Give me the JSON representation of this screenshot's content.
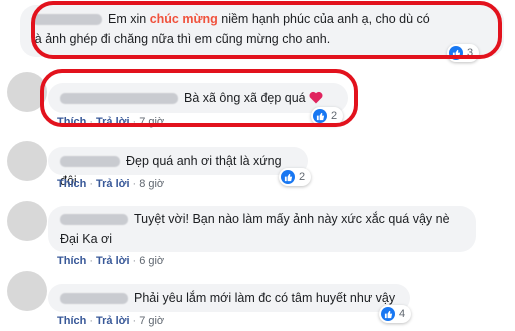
{
  "comments": [
    {
      "text_before": "Em xin ",
      "highlight": "chúc mừng",
      "text_after": " niềm hạnh phúc của anh ạ, cho dù có",
      "text_line2": "là ảnh ghép đi chăng nữa thì em cũng mừng cho anh.",
      "reactions": "3"
    },
    {
      "text": "Bà xã ông xã đẹp quá",
      "emoji": "heart-icon",
      "like": "Thích",
      "reply": "Trả lời",
      "time": "7 giờ",
      "reactions": "2"
    },
    {
      "text": "Đẹp quá anh ơi thật là xứng đôi",
      "like": "Thích",
      "reply": "Trả lời",
      "time": "8 giờ",
      "reactions": "2"
    },
    {
      "text_line1": "Tuyệt vời! Bạn nào làm mấy ảnh này xức xắc quá vậy nè",
      "text_line2": "Đại Ka ơi",
      "like": "Thích",
      "reply": "Trả lời",
      "time": "6 giờ"
    },
    {
      "text": "Phải yêu lắm mới làm đc có tâm huyết như vậy",
      "like": "Thích",
      "reply": "Trả lời",
      "time": "7 giờ",
      "reactions": "4"
    }
  ],
  "colors": {
    "highlight_box": "#e2121d",
    "link": "#385898",
    "like_badge": "#1877f2"
  }
}
